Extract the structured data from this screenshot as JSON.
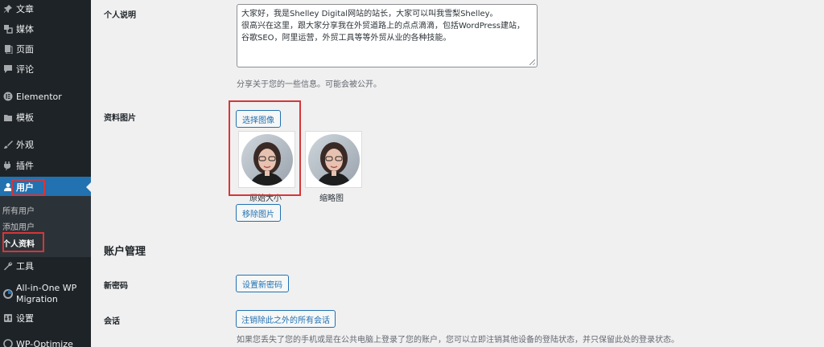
{
  "sidebar": {
    "items": [
      {
        "label": "文章",
        "icon": "pushpin-icon"
      },
      {
        "label": "媒体",
        "icon": "media-icon"
      },
      {
        "label": "页面",
        "icon": "page-icon"
      },
      {
        "label": "评论",
        "icon": "comment-icon"
      },
      {
        "label": "Elementor",
        "icon": "elementor-icon"
      },
      {
        "label": "模板",
        "icon": "folder-icon"
      },
      {
        "label": "外观",
        "icon": "brush-icon"
      },
      {
        "label": "插件",
        "icon": "plugin-icon"
      },
      {
        "label": "用户",
        "icon": "user-icon"
      },
      {
        "label": "工具",
        "icon": "wrench-icon"
      },
      {
        "label_line1": "All-in-One WP",
        "label_line2": "Migration",
        "icon": "migration-icon"
      },
      {
        "label": "设置",
        "icon": "settings-icon"
      },
      {
        "label": "WP-Optimize",
        "icon": "optimize-icon"
      }
    ],
    "submenu": [
      {
        "label": "所有用户"
      },
      {
        "label": "添加用户"
      },
      {
        "label": "个人资料"
      }
    ]
  },
  "profile": {
    "bio_label": "个人说明",
    "bio_lines": [
      "大家好，我是Shelley Digital网站的站长，大家可以叫我雪梨Shelley。",
      "很高兴在这里，跟大家分享我在外贸道路上的点点滴滴，包括WordPress建站，",
      "谷歌SEO，阿里运营，外贸工具等等外贸从业的各种技能。"
    ],
    "bio_desc": "分享关于您的一些信息。可能会被公开。",
    "picture_label": "资料图片",
    "choose_image_button": "选择图像",
    "original_size_caption": "原始大小",
    "thumbnail_caption": "缩略图",
    "remove_image_button": "移除图片"
  },
  "account": {
    "section_title": "账户管理",
    "new_password_label": "新密码",
    "set_password_button": "设置新密码",
    "sessions_label": "会话",
    "logout_others_button": "注销除此之外的所有会话",
    "sessions_desc": "如果您丢失了您的手机或是在公共电脑上登录了您的账户，您可以立即注销其他设备的登陆状态，并只保留此处的登录状态。"
  },
  "colors": {
    "sidebar_bg": "#1d2327",
    "active_bg": "#2271b1",
    "highlight_red": "#d63638"
  }
}
